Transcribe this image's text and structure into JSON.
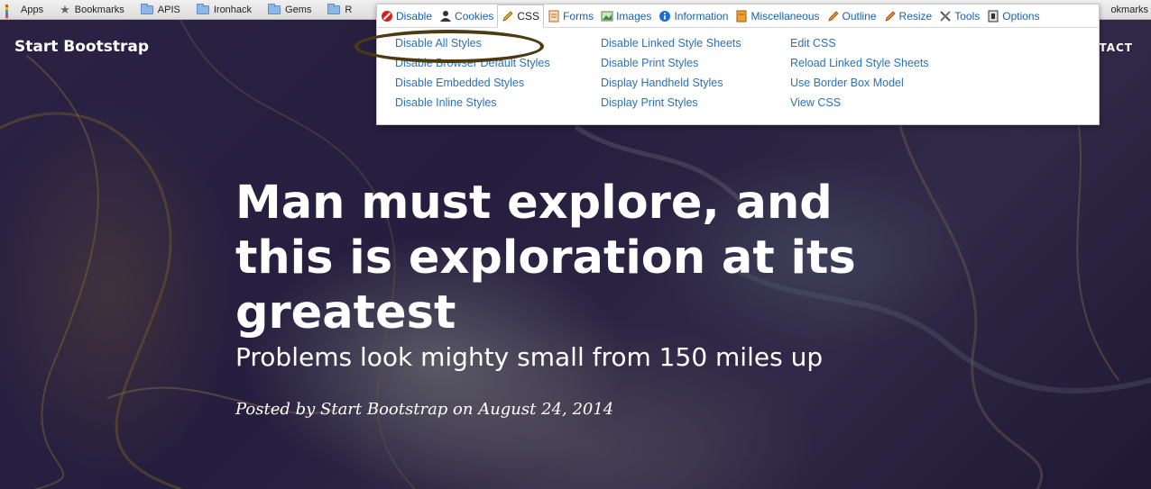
{
  "bookmarks": {
    "items": [
      {
        "label": "Apps",
        "icon": "apps-grid-icon"
      },
      {
        "label": "Bookmarks",
        "icon": "star-icon"
      },
      {
        "label": "APIS",
        "icon": "folder-icon"
      },
      {
        "label": "Ironhack",
        "icon": "folder-icon"
      },
      {
        "label": "Gems",
        "icon": "folder-icon"
      },
      {
        "label": "R",
        "icon": "folder-icon"
      }
    ],
    "right_label": "okmarks"
  },
  "site": {
    "brand": "Start Bootstrap",
    "nav_contact": "TACT",
    "heading": "Man must explore, and this is exploration at its greatest",
    "subheading": "Problems look mighty small from 150 miles up",
    "meta": "Posted by Start Bootstrap on August 24, 2014"
  },
  "webdev": {
    "tabs": [
      {
        "label": "Disable",
        "icon": "no-entry-icon",
        "color": "#d42020"
      },
      {
        "label": "Cookies",
        "icon": "person-icon",
        "color": "#333333"
      },
      {
        "label": "CSS",
        "icon": "pencil-icon",
        "color": "#e0b020",
        "active": true
      },
      {
        "label": "Forms",
        "icon": "form-icon",
        "color": "#c06020"
      },
      {
        "label": "Images",
        "icon": "image-icon",
        "color": "#4a8a3a"
      },
      {
        "label": "Information",
        "icon": "info-icon",
        "color": "#1a6fd0"
      },
      {
        "label": "Miscellaneous",
        "icon": "box-icon",
        "color": "#d08a20"
      },
      {
        "label": "Outline",
        "icon": "pencil-icon",
        "color": "#e07020"
      },
      {
        "label": "Resize",
        "icon": "pencil-icon",
        "color": "#e07020"
      },
      {
        "label": "Tools",
        "icon": "tools-icon",
        "color": "#555555"
      },
      {
        "label": "Options",
        "icon": "options-icon",
        "color": "#333333"
      }
    ],
    "menu_columns": [
      [
        "Disable All Styles",
        "Disable Browser Default Styles",
        "Disable Embedded Styles",
        "Disable Inline Styles"
      ],
      [
        "Disable Linked Style Sheets",
        "Disable Print Styles",
        "Display Handheld Styles",
        "Display Print Styles"
      ],
      [
        "Edit CSS",
        "Reload Linked Style Sheets",
        "Use Border Box Model",
        "View CSS"
      ]
    ]
  },
  "colors": {
    "link": "#2a71b8",
    "annotation_circle": "#4d3a10"
  }
}
